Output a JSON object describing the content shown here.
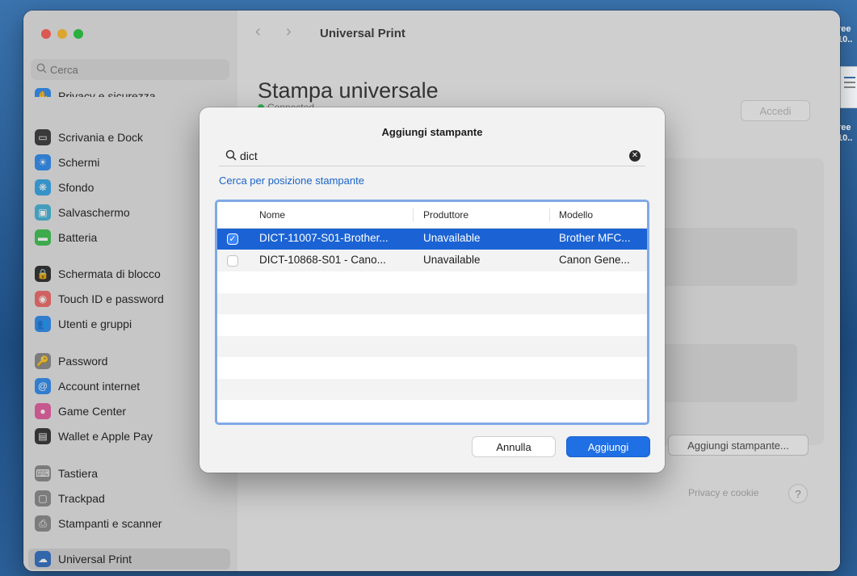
{
  "desktop": {
    "fragment_top": "ree\n10..",
    "fragment_bottom": "ree\n10.."
  },
  "sidebar": {
    "search_placeholder": "Cerca",
    "partial_item": "Privacy e sicurezza",
    "items": [
      {
        "label": "Scrivania e Dock",
        "icon": "dock-icon",
        "color": "#3a3a3a"
      },
      {
        "label": "Schermi",
        "icon": "display-icon",
        "color": "#2f8cf0"
      },
      {
        "label": "Sfondo",
        "icon": "wallpaper-icon",
        "color": "#35a7e8"
      },
      {
        "label": "Salvaschermo",
        "icon": "screensaver-icon",
        "color": "#45b4d8"
      },
      {
        "label": "Batteria",
        "icon": "battery-icon",
        "color": "#3ec24f"
      },
      {
        "label": "Schermata di blocco",
        "icon": "lock-icon",
        "color": "#2d2d2d"
      },
      {
        "label": "Touch ID e password",
        "icon": "fingerprint-icon",
        "color": "#f06a6a"
      },
      {
        "label": "Utenti e gruppi",
        "icon": "users-icon",
        "color": "#2f8cf0"
      },
      {
        "label": "Password",
        "icon": "key-icon",
        "color": "#8a8a8a"
      },
      {
        "label": "Account internet",
        "icon": "at-icon",
        "color": "#2f8cf0"
      },
      {
        "label": "Game Center",
        "icon": "game-center-icon",
        "color": "#e45ea0"
      },
      {
        "label": "Wallet e Apple Pay",
        "icon": "wallet-icon",
        "color": "#333333"
      },
      {
        "label": "Tastiera",
        "icon": "keyboard-icon",
        "color": "#8a8a8a"
      },
      {
        "label": "Trackpad",
        "icon": "trackpad-icon",
        "color": "#8a8a8a"
      },
      {
        "label": "Stampanti e scanner",
        "icon": "printer-icon",
        "color": "#8a8a8a"
      },
      {
        "label": "Universal Print",
        "icon": "universal-print-icon",
        "color": "#2f6fc4",
        "selected": true
      }
    ]
  },
  "main": {
    "title": "Universal Print",
    "heading": "Stampa universale",
    "status": "Connected",
    "signin_label": "Accedi",
    "add_printer_label": "Aggiungi stampante...",
    "privacy_label": "Privacy e cookie",
    "help_label": "?"
  },
  "dialog": {
    "title": "Aggiungi stampante",
    "search_value": "dict",
    "location_link": "Cerca per posizione stampante",
    "columns": [
      "Nome",
      "Produttore",
      "Modello"
    ],
    "rows": [
      {
        "name": "DICT-11007-S01-Brother...",
        "manufacturer": "Unavailable",
        "model": "Brother MFC...",
        "checked": true
      },
      {
        "name": "DICT-10868-S01 - Cano...",
        "manufacturer": "Unavailable",
        "model": "Canon Gene...",
        "checked": false
      }
    ],
    "cancel_label": "Annulla",
    "add_label": "Aggiungi"
  }
}
